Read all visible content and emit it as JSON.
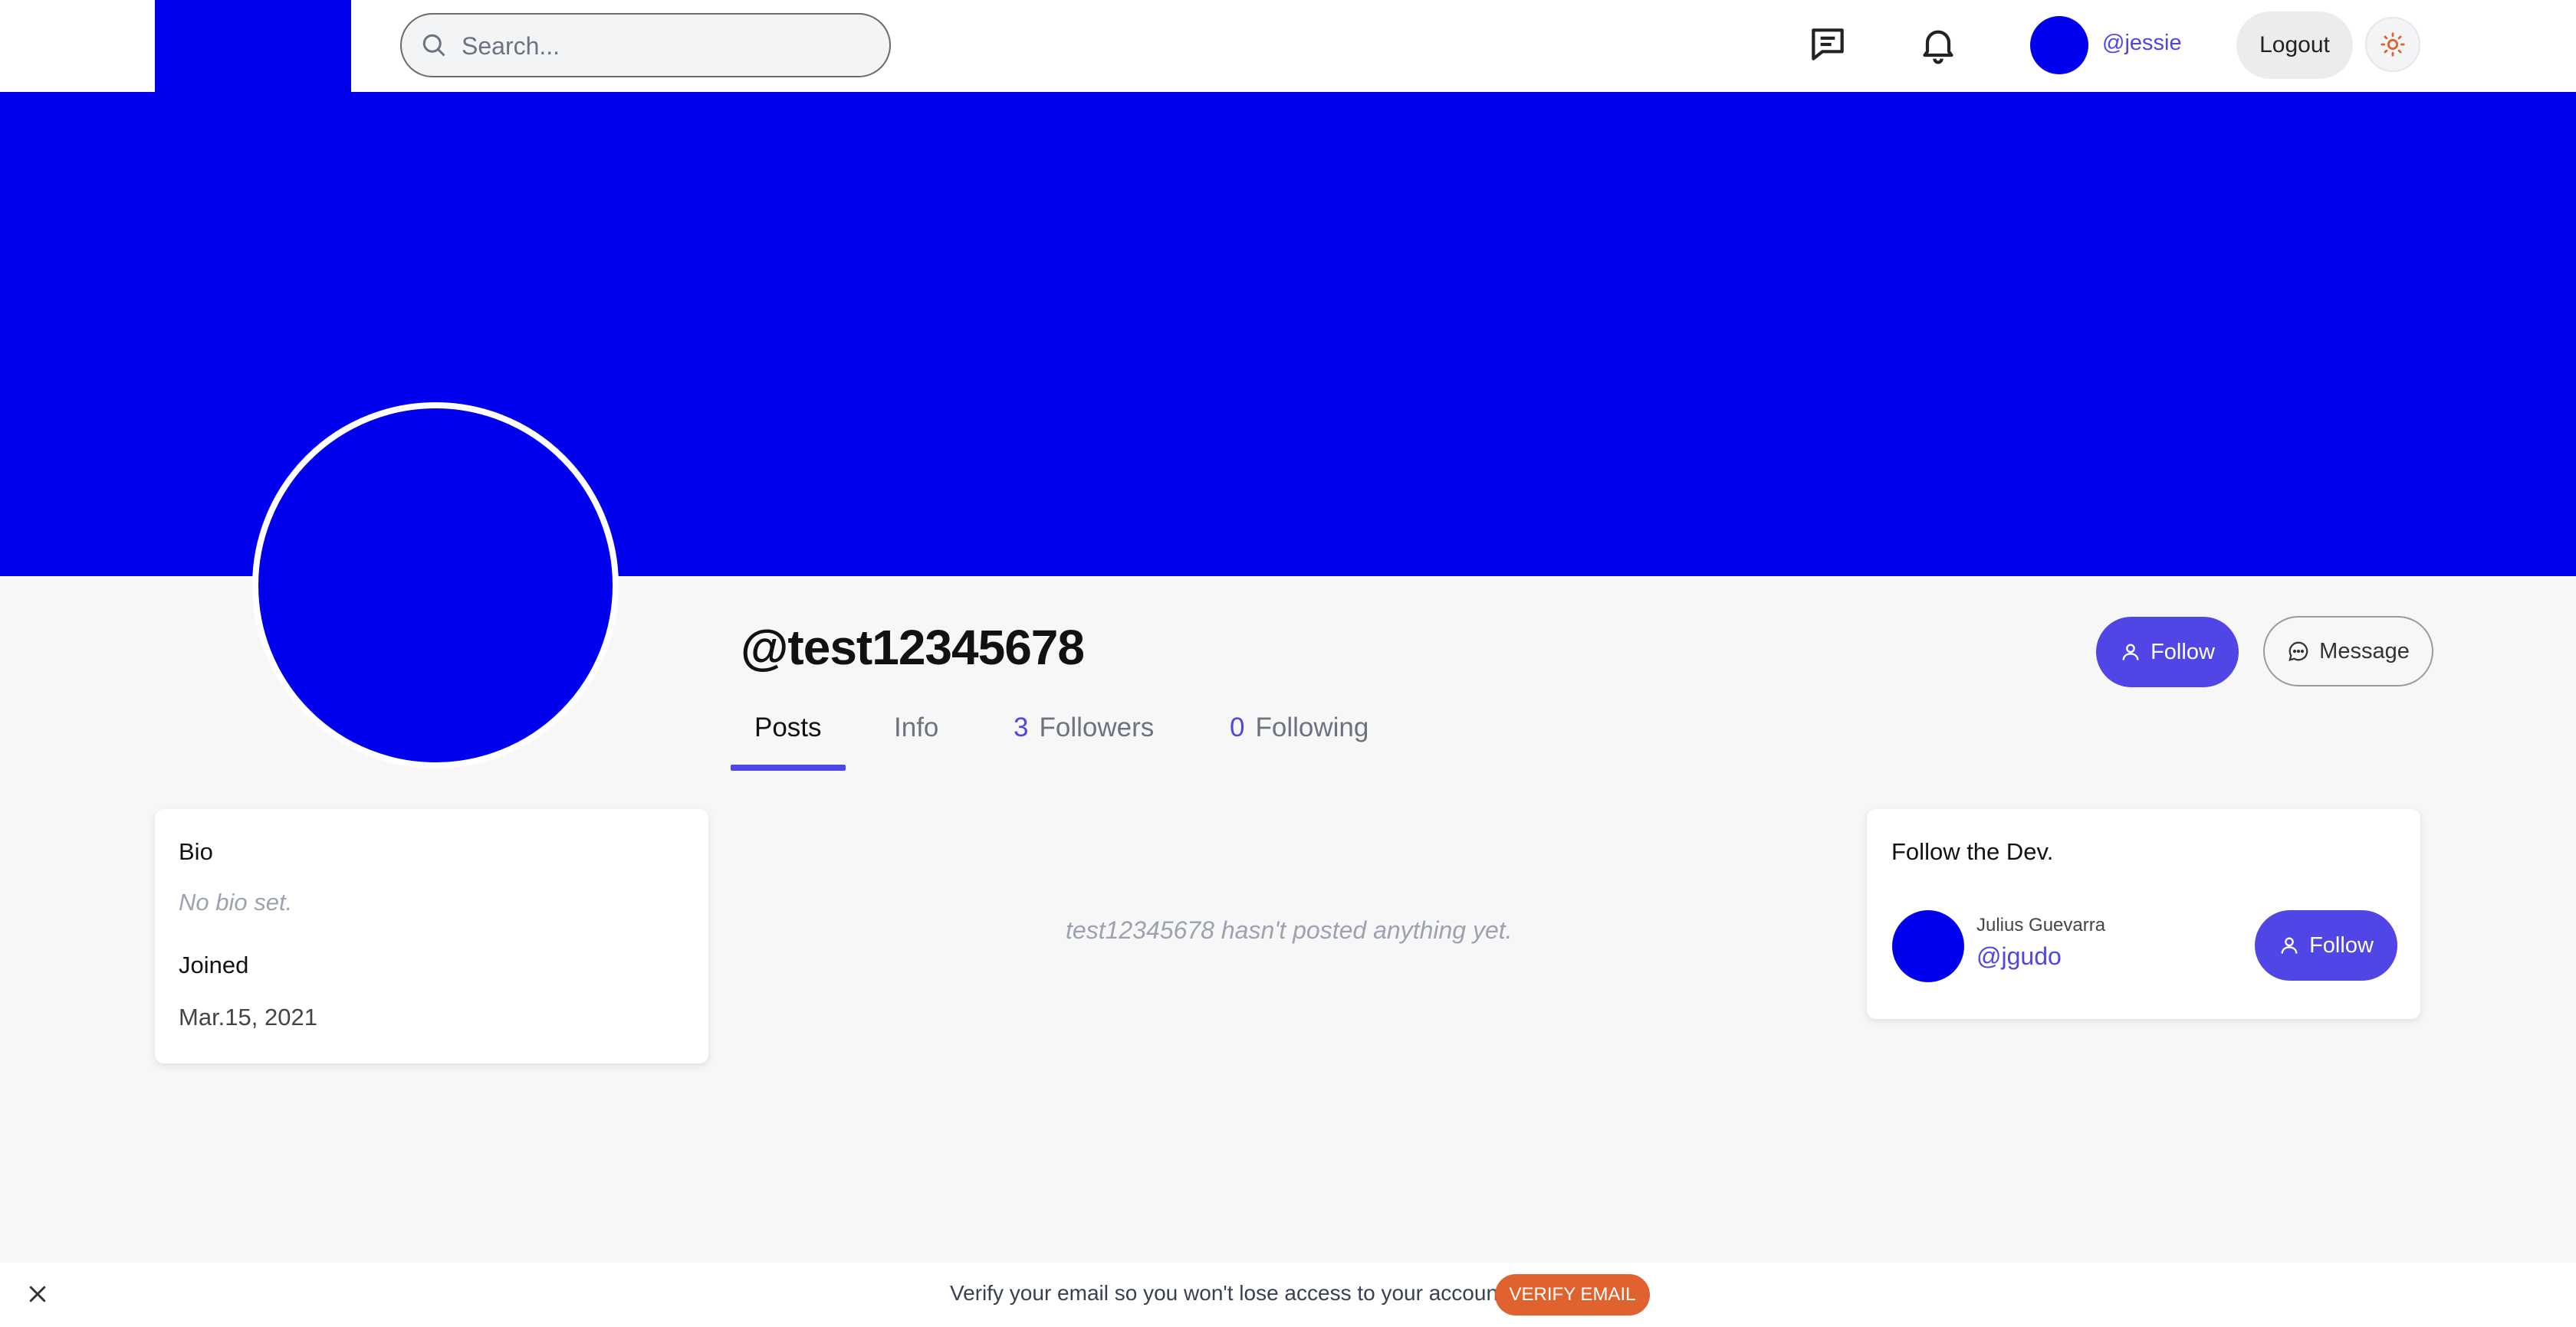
{
  "header": {
    "search_placeholder": "Search...",
    "username": "@jessie",
    "logout_label": "Logout"
  },
  "profile": {
    "handle": "@test12345678",
    "follow_label": "Follow",
    "message_label": "Message",
    "tabs": {
      "posts": "Posts",
      "info": "Info",
      "followers_count": "3",
      "followers_label": "Followers",
      "following_count": "0",
      "following_label": "Following"
    },
    "empty_posts": "test12345678 hasn't posted anything yet."
  },
  "bio_card": {
    "bio_label": "Bio",
    "bio_text": "No bio set.",
    "joined_label": "Joined",
    "joined_date": "Mar.15, 2021"
  },
  "follow_dev": {
    "title": "Follow the Dev.",
    "name": "Julius Guevarra",
    "handle": "@jgudo",
    "follow_label": "Follow"
  },
  "verify_bar": {
    "message": "Verify your email so you won't lose access to your account.",
    "button_label": "VERIFY EMAIL"
  },
  "colors": {
    "brand_blue": "#0000ee",
    "accent": "#4f46e5",
    "verify": "#e0622e"
  },
  "icons": [
    "search-icon",
    "chat-icon",
    "bell-icon",
    "sun-icon",
    "user-icon",
    "message-icon",
    "close-icon"
  ]
}
